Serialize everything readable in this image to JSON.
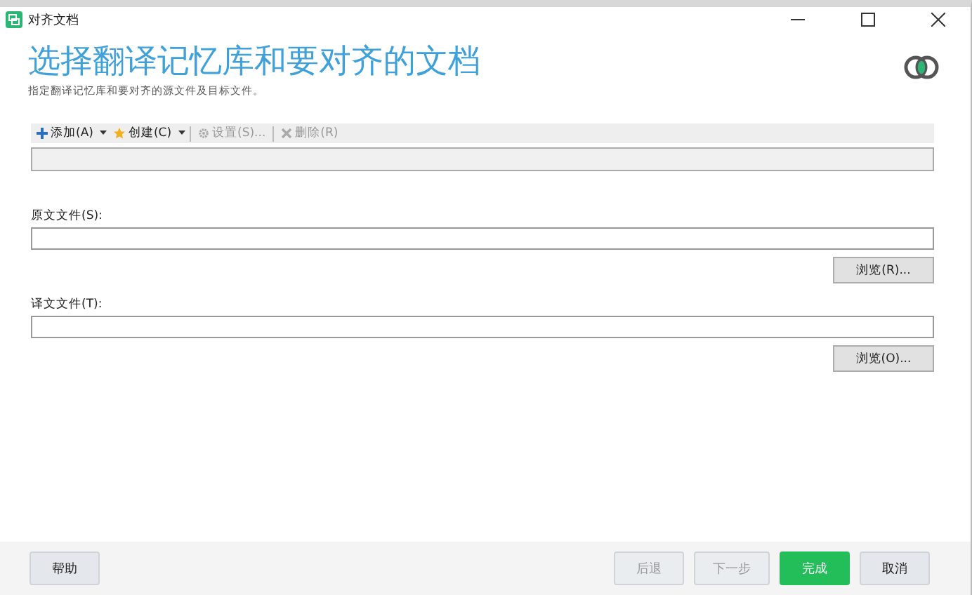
{
  "window": {
    "title": "对齐文档"
  },
  "header": {
    "title": "选择翻译记忆库和要对齐的文档",
    "subtitle": "指定翻译记忆库和要对齐的源文件及目标文件。"
  },
  "toolbar": [
    {
      "label": "添加(A)",
      "kind": "add",
      "dropdown": true,
      "disabled": false
    },
    {
      "label": "创建(C)",
      "kind": "create",
      "dropdown": true,
      "disabled": false
    },
    {
      "label": "设置(S)...",
      "kind": "settings",
      "dropdown": false,
      "disabled": true
    },
    {
      "label": "删除(R)",
      "kind": "delete",
      "dropdown": false,
      "disabled": true
    }
  ],
  "files": [
    {
      "label": "原文文件(S):",
      "browse": "浏览(R)..."
    },
    {
      "label": "译文文件(T):",
      "browse": "浏览(O)..."
    }
  ],
  "footer": {
    "help": "帮助",
    "buttons": [
      {
        "label": "后退",
        "kind": "normal",
        "disabled": true
      },
      {
        "label": "下一步",
        "kind": "normal",
        "disabled": true
      },
      {
        "label": "完成",
        "kind": "primary",
        "disabled": false
      },
      {
        "label": "取消",
        "kind": "normal",
        "disabled": false
      }
    ]
  }
}
